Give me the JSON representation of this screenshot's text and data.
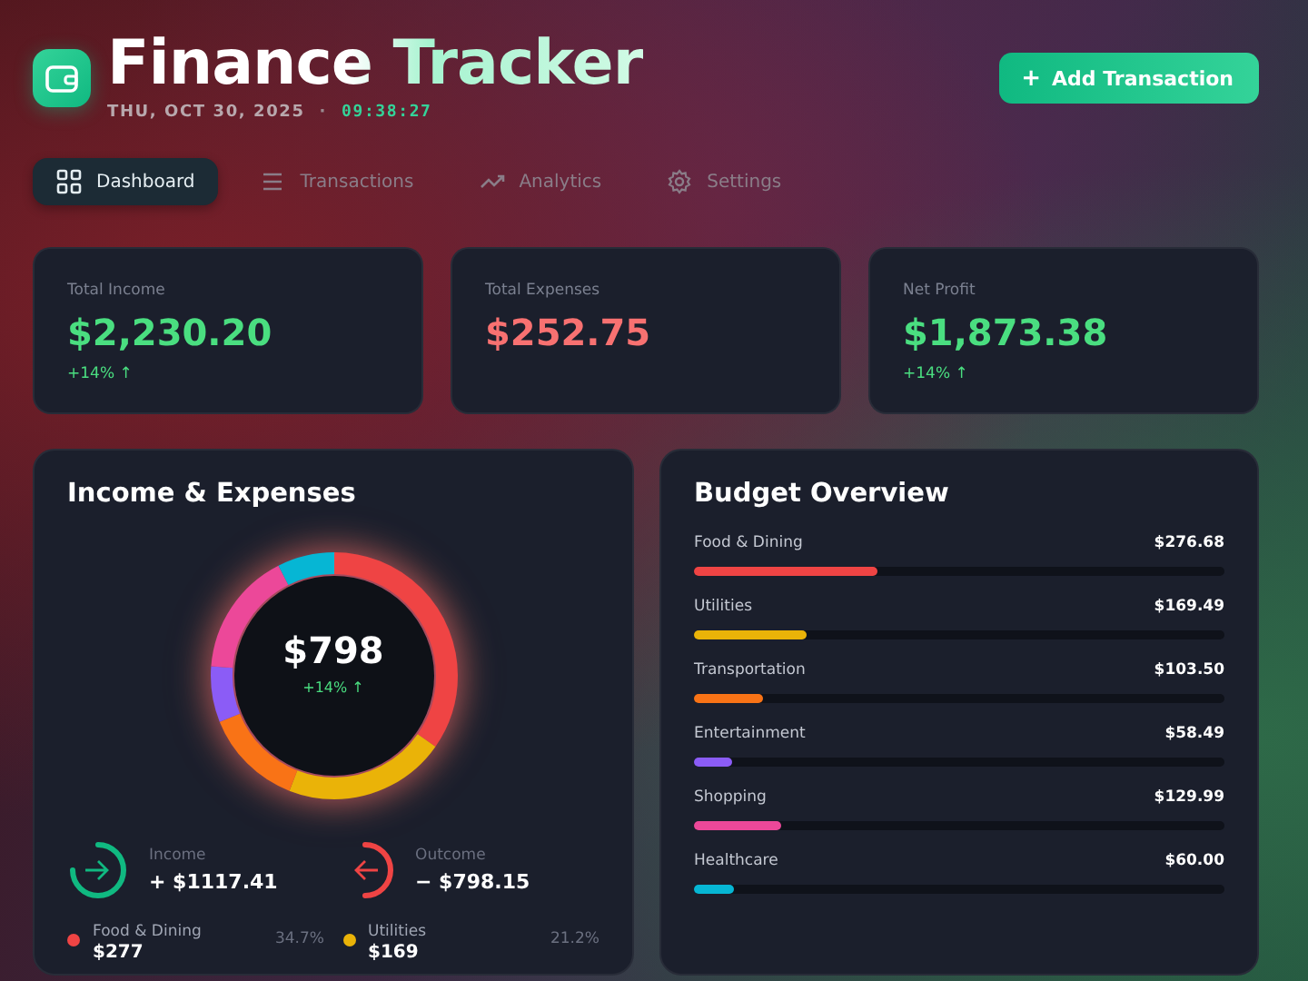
{
  "header": {
    "title": "Finance Tracker",
    "date": "THU, OCT 30, 2025",
    "separator": "·",
    "time": "09:38:27"
  },
  "add_button": {
    "icon": "+",
    "label": "Add Transaction"
  },
  "nav": [
    {
      "label": "Dashboard",
      "selected": true
    },
    {
      "label": "Transactions",
      "selected": false
    },
    {
      "label": "Analytics",
      "selected": false
    },
    {
      "label": "Settings",
      "selected": false
    }
  ],
  "stats": [
    {
      "label": "Total Income",
      "value": "$2,230.20",
      "kind": "gain",
      "change": "+14% ↑"
    },
    {
      "label": "Total Expenses",
      "value": "$252.75",
      "kind": "loss"
    },
    {
      "label": "Net Profit",
      "value": "$1,873.38",
      "kind": "gain",
      "change": "+14% ↑"
    }
  ],
  "income_expenses": {
    "title": "Income & Expenses",
    "center_value": "$798",
    "center_change": "+14% ↑",
    "flows": [
      {
        "kind": "income",
        "label": "Income",
        "amount": "+ $1117.41"
      },
      {
        "kind": "outcome",
        "label": "Outcome",
        "amount": "− $798.15"
      }
    ],
    "legend": [
      {
        "name": "Food & Dining",
        "amount": "$277",
        "share": "34.7%",
        "color": "#ef4444"
      },
      {
        "name": "Utilities",
        "amount": "$169",
        "share": "21.2%",
        "color": "#eab308"
      }
    ]
  },
  "budget": {
    "title": "Budget Overview",
    "items": [
      {
        "name": "Food & Dining",
        "amount": "$276.68",
        "level": 0.347,
        "color": "#ef4444"
      },
      {
        "name": "Utilities",
        "amount": "$169.49",
        "level": 0.212,
        "color": "#eab308"
      },
      {
        "name": "Transportation",
        "amount": "$103.50",
        "level": 0.13,
        "color": "#f97316"
      },
      {
        "name": "Entertainment",
        "amount": "$58.49",
        "level": 0.073,
        "color": "#8b5cf6"
      },
      {
        "name": "Shopping",
        "amount": "$129.99",
        "level": 0.163,
        "color": "#ec4899"
      },
      {
        "name": "Healthcare",
        "amount": "$60.00",
        "level": 0.075,
        "color": "#06b6d4"
      }
    ]
  }
}
